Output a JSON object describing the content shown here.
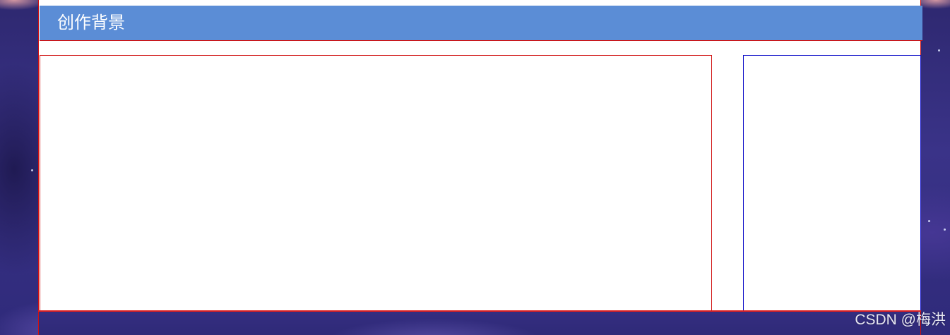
{
  "section": {
    "title": "创作背景"
  },
  "watermark": {
    "text": "CSDN @梅洪"
  },
  "colors": {
    "header_bar": "#5b8dd6",
    "panel_background": "#ffffff",
    "main_box_border": "#d01010",
    "side_box_border": "#1010c8",
    "page_background": "#2e2870"
  }
}
